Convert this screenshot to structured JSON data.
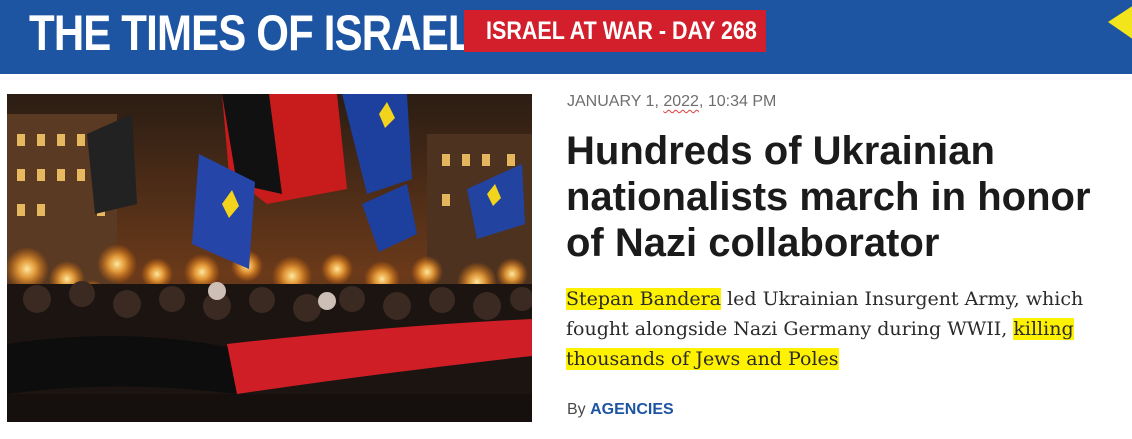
{
  "header": {
    "logo": "THE TIMES OF ISRAEL",
    "war_badge": "ISRAEL AT WAR - DAY 268",
    "colors": {
      "brand_blue": "#1e55a3",
      "badge_red": "#d21f2b",
      "corner_yellow": "#f2e51c"
    }
  },
  "article": {
    "date_prefix": "JANUARY 1, ",
    "date_year": "2022",
    "date_time": ", 10:34 PM",
    "headline": "Hundreds of Ukrainian nationalists march in honor of Nazi collaborator",
    "summary": {
      "hl1": "Stepan Bandera",
      "mid": " led Ukrainian Insurgent Army, which fought alongside Nazi Germany during WWII, ",
      "hl2": "killing thousands of Jews and Poles"
    },
    "byline_prefix": "By ",
    "byline_author": "AGENCIES",
    "photo_alt": "Torchlight march with blue-and-yellow and red-and-black flags at night"
  }
}
